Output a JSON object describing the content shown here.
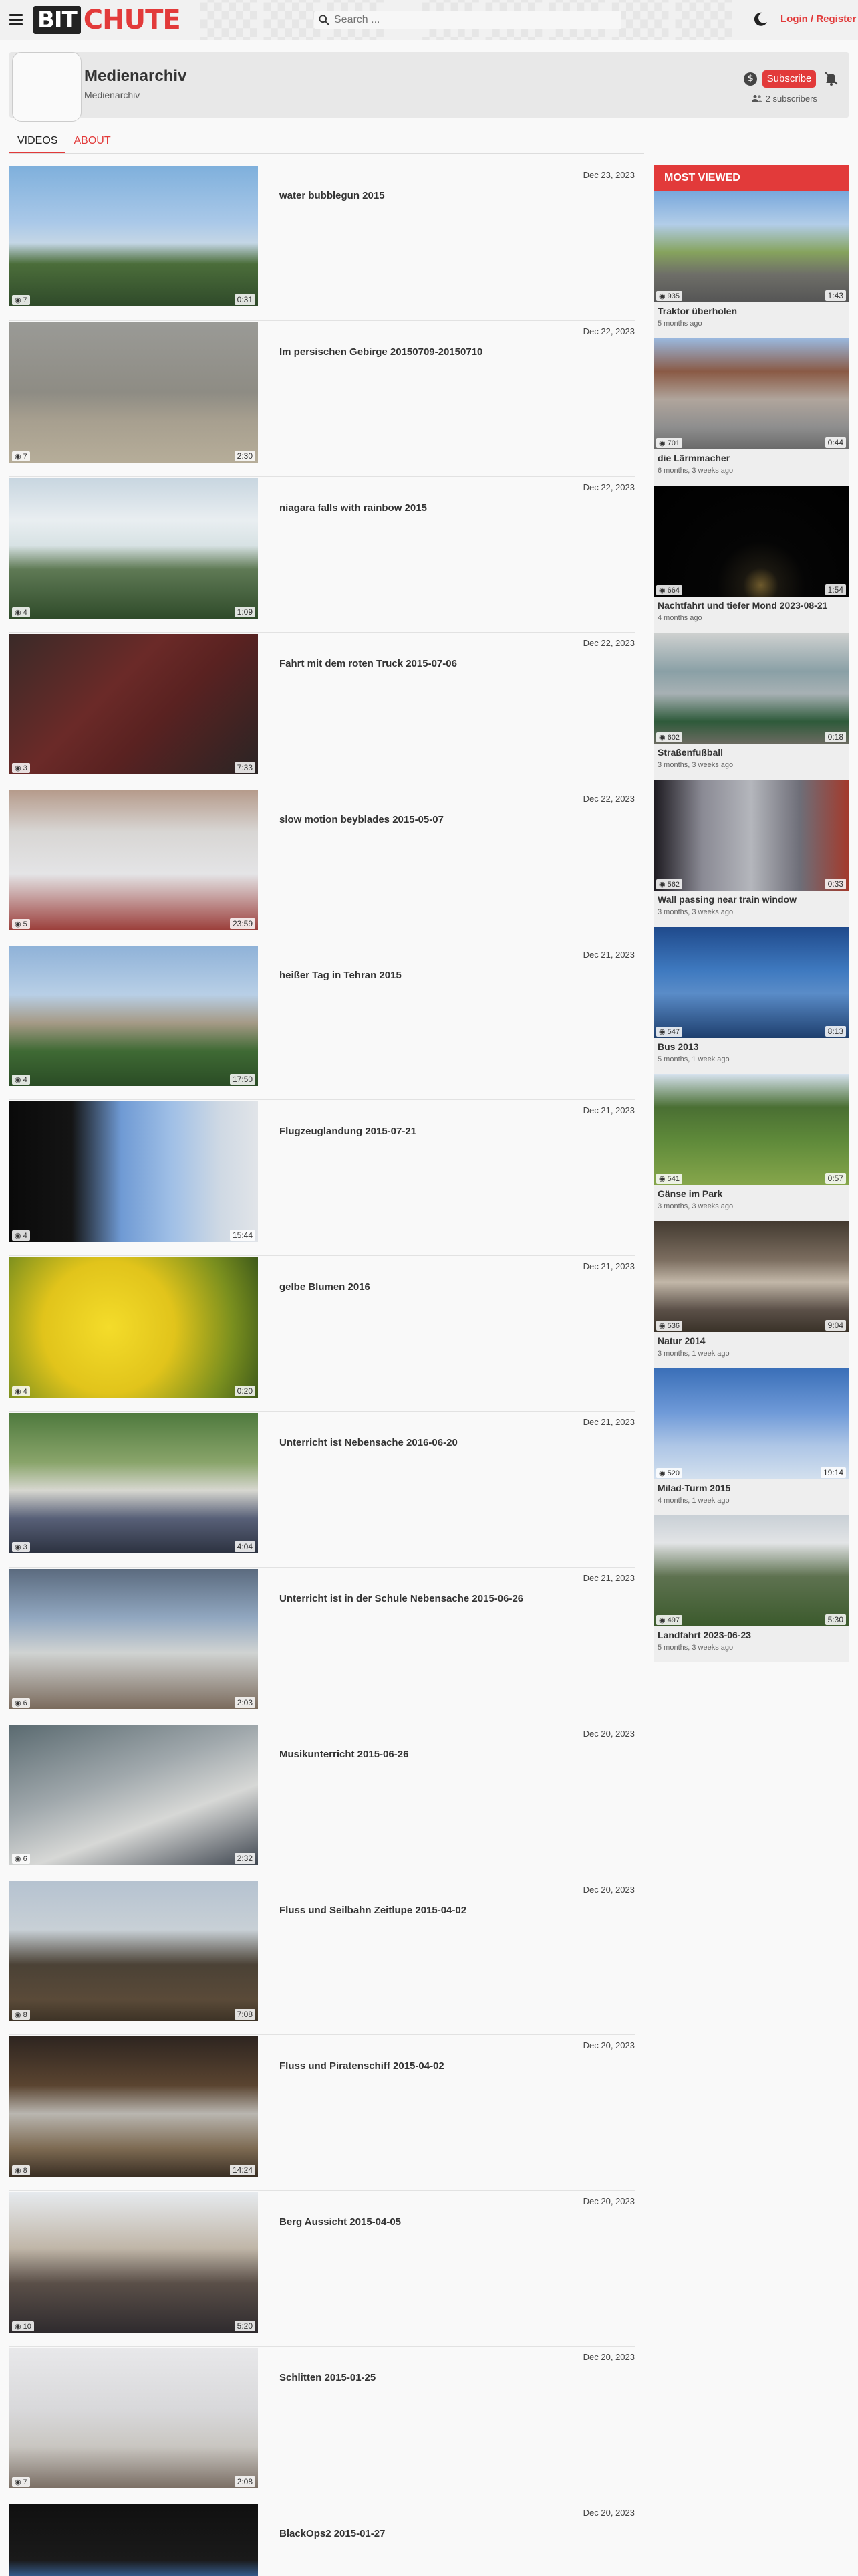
{
  "header": {
    "logo_bit": "BIT",
    "logo_chute": "CHUTE",
    "search_placeholder": "Search ...",
    "login_label": "Login / Register"
  },
  "channel": {
    "name": "Medienarchiv",
    "handle": "Medienarchiv",
    "subscribe_label": "Subscribe",
    "subscribers": "2 subscribers"
  },
  "tabs": [
    {
      "label": "VIDEOS"
    },
    {
      "label": "ABOUT"
    }
  ],
  "videos": [
    {
      "title": "water bubblegun 2015",
      "date": "Dec 23, 2023",
      "views": "7",
      "duration": "0:31"
    },
    {
      "title": "Im persischen Gebirge 20150709-20150710",
      "date": "Dec 22, 2023",
      "views": "7",
      "duration": "2:30"
    },
    {
      "title": "niagara falls with rainbow 2015",
      "date": "Dec 22, 2023",
      "views": "4",
      "duration": "1:09"
    },
    {
      "title": "Fahrt mit dem roten Truck 2015-07-06",
      "date": "Dec 22, 2023",
      "views": "3",
      "duration": "7:33"
    },
    {
      "title": "slow motion beyblades 2015-05-07",
      "date": "Dec 22, 2023",
      "views": "5",
      "duration": "23:59"
    },
    {
      "title": "heißer Tag in Tehran 2015",
      "date": "Dec 21, 2023",
      "views": "4",
      "duration": "17:50"
    },
    {
      "title": "Flugzeuglandung 2015-07-21",
      "date": "Dec 21, 2023",
      "views": "4",
      "duration": "15:44"
    },
    {
      "title": "gelbe Blumen 2016",
      "date": "Dec 21, 2023",
      "views": "4",
      "duration": "0:20"
    },
    {
      "title": "Unterricht ist Nebensache 2016-06-20",
      "date": "Dec 21, 2023",
      "views": "3",
      "duration": "4:04"
    },
    {
      "title": "Unterricht ist in der Schule Nebensache 2015-06-26",
      "date": "Dec 21, 2023",
      "views": "6",
      "duration": "2:03"
    },
    {
      "title": "Musikunterricht 2015-06-26",
      "date": "Dec 20, 2023",
      "views": "6",
      "duration": "2:32"
    },
    {
      "title": "Fluss und Seilbahn Zeitlupe 2015-04-02",
      "date": "Dec 20, 2023",
      "views": "8",
      "duration": "7:08"
    },
    {
      "title": "Fluss und Piratenschiff 2015-04-02",
      "date": "Dec 20, 2023",
      "views": "8",
      "duration": "14:24"
    },
    {
      "title": "Berg Aussicht 2015-04-05",
      "date": "Dec 20, 2023",
      "views": "10",
      "duration": "5:20"
    },
    {
      "title": "Schlitten 2015-01-25",
      "date": "Dec 20, 2023",
      "views": "7",
      "duration": "2:08"
    },
    {
      "title": "BlackOps2 2015-01-27",
      "date": "Dec 20, 2023",
      "views": "",
      "duration": ""
    }
  ],
  "sidebar": {
    "heading": "MOST VIEWED",
    "items": [
      {
        "title": "Traktor überholen",
        "ago": "5 months ago",
        "views": "935",
        "duration": "1:43"
      },
      {
        "title": "die Lärmmacher",
        "ago": "6 months, 3 weeks ago",
        "views": "701",
        "duration": "0:44"
      },
      {
        "title": "Nachtfahrt und tiefer Mond 2023-08-21",
        "ago": "4 months ago",
        "views": "664",
        "duration": "1:54"
      },
      {
        "title": "Straßenfußball",
        "ago": "3 months, 3 weeks ago",
        "views": "602",
        "duration": "0:18"
      },
      {
        "title": "Wall passing near train window",
        "ago": "3 months, 3 weeks ago",
        "views": "562",
        "duration": "0:33"
      },
      {
        "title": "Bus 2013",
        "ago": "5 months, 1 week ago",
        "views": "547",
        "duration": "8:13"
      },
      {
        "title": "Gänse im Park",
        "ago": "3 months, 3 weeks ago",
        "views": "541",
        "duration": "0:57"
      },
      {
        "title": "Natur 2014",
        "ago": "3 months, 1 week ago",
        "views": "536",
        "duration": "9:04"
      },
      {
        "title": "Milad-Turm 2015",
        "ago": "4 months, 1 week ago",
        "views": "520",
        "duration": "19:14"
      },
      {
        "title": "Landfahrt 2023-06-23",
        "ago": "5 months, 3 weeks ago",
        "views": "497",
        "duration": "5:30"
      }
    ]
  },
  "colors": {
    "accent": "#e23a3a",
    "background": "#f9f9f9",
    "header_bg": "#f1f1f1"
  },
  "icons": {
    "menu": "hamburger-icon",
    "search": "search-icon",
    "theme": "moon-icon",
    "tip": "coin-icon",
    "notify": "bell-off-icon",
    "subscribers": "users-icon",
    "views": "eye-icon"
  }
}
